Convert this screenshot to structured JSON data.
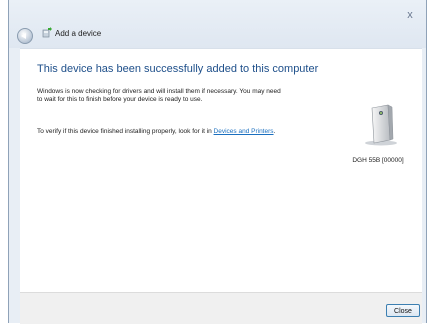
{
  "window": {
    "title": "Add a device",
    "close_glyph": "x"
  },
  "content": {
    "heading": "This device has been successfully added to this computer",
    "para1": "Windows is now checking for drivers and will install them if necessary. You may need to wait for this to finish before your device is ready to use.",
    "para2_prefix": "To verify if this device finished installing properly, look for it in ",
    "para2_link": "Devices and Printers",
    "para2_suffix": "."
  },
  "device": {
    "name": "DGH 55B [00000]",
    "icon": "device-tower-icon"
  },
  "footer": {
    "close_label": "Close"
  },
  "colors": {
    "heading": "#1e4f8a",
    "link": "#1a6fbf",
    "button_border": "#3c7fb1"
  }
}
